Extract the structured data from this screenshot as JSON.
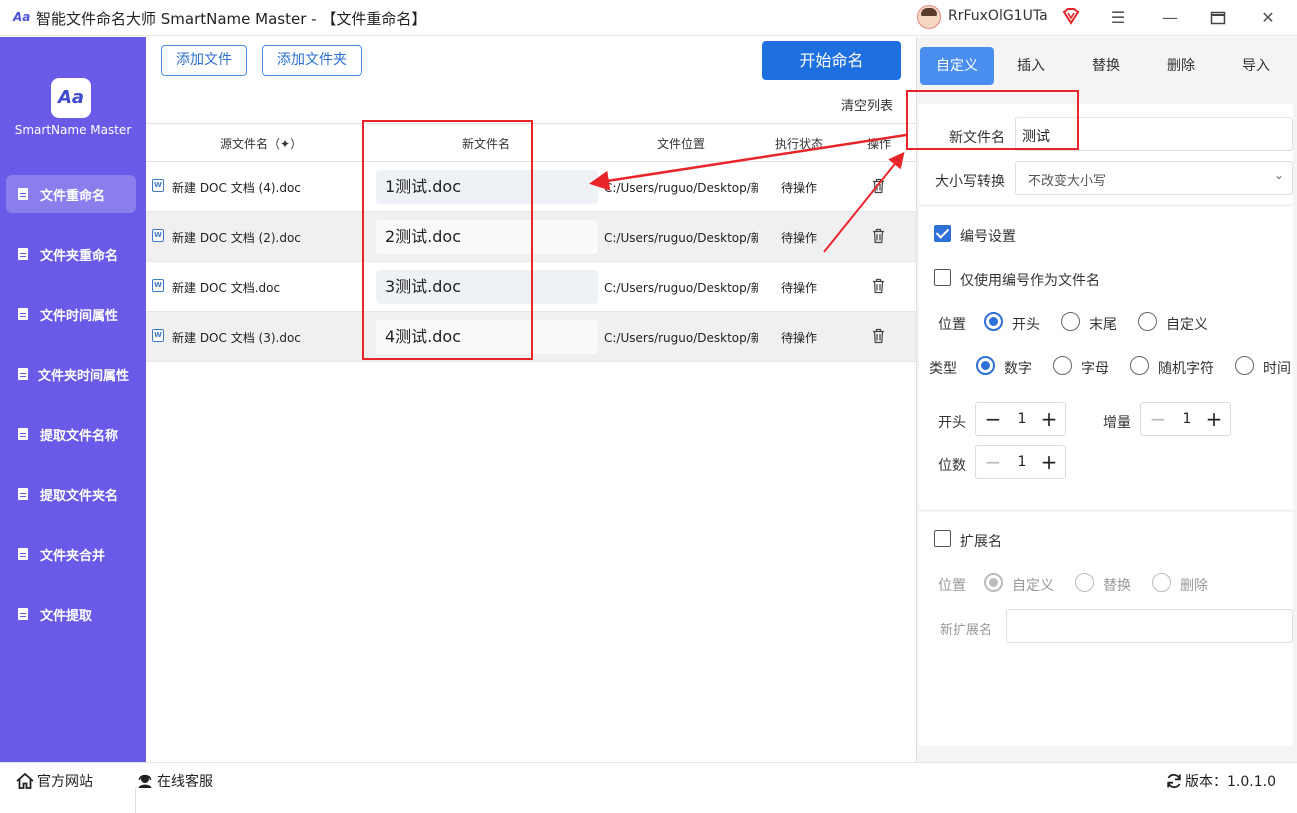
{
  "window": {
    "title": "智能文件命名大师 SmartName Master - 【文件重命名】",
    "app_icon": "Aa",
    "username": "RrFuxOlG1UTa",
    "vip_icon": "diamond-badge-icon",
    "controls": [
      "menu-icon",
      "minimize-icon",
      "maximize-icon",
      "close-icon"
    ]
  },
  "sidebar": {
    "logo_text": "Aa",
    "brand": "SmartName Master",
    "items": [
      {
        "label": "文件重命名",
        "active": true
      },
      {
        "label": "文件夹重命名",
        "active": false
      },
      {
        "label": "文件时间属性",
        "active": false
      },
      {
        "label": "文件夹时间属性",
        "active": false
      },
      {
        "label": "提取文件名称",
        "active": false
      },
      {
        "label": "提取文件夹名",
        "active": false
      },
      {
        "label": "文件夹合并",
        "active": false
      },
      {
        "label": "文件提取",
        "active": false
      }
    ]
  },
  "toolbar": {
    "add_file": "添加文件",
    "add_folder": "添加文件夹",
    "start": "开始命名",
    "clear": "清空列表"
  },
  "table": {
    "headers": {
      "source": "源文件名（",
      "source_sort_icon": "sort-icon",
      "source_close": "）",
      "new_name": "新文件名",
      "location": "文件位置",
      "status": "执行状态",
      "action": "操作"
    },
    "rows": [
      {
        "source": "新建 DOC 文档 (4).doc",
        "new_name": "1测试.doc",
        "location": "C:/Users/ruguo/Desktop/新",
        "status": "待操作"
      },
      {
        "source": "新建 DOC 文档 (2).doc",
        "new_name": "2测试.doc",
        "location": "C:/Users/ruguo/Desktop/新",
        "status": "待操作"
      },
      {
        "source": "新建 DOC 文档.doc",
        "new_name": "3测试.doc",
        "location": "C:/Users/ruguo/Desktop/新",
        "status": "待操作"
      },
      {
        "source": "新建 DOC 文档 (3).doc",
        "new_name": "4测试.doc",
        "location": "C:/Users/ruguo/Desktop/新",
        "status": "待操作"
      }
    ]
  },
  "panel": {
    "tabs": [
      "自定义",
      "插入",
      "替换",
      "删除",
      "导入"
    ],
    "active_tab": "自定义",
    "new_name_label": "新文件名",
    "new_name_value": "测试",
    "case_label": "大小写转换",
    "case_value": "不改变大小写",
    "numbering": {
      "label": "编号设置",
      "checked": true,
      "only_number_label": "仅使用编号作为文件名",
      "only_number_checked": false,
      "position_label": "位置",
      "position_options": [
        "开头",
        "末尾",
        "自定义"
      ],
      "position_selected": "开头",
      "type_label": "类型",
      "type_options": [
        "数字",
        "字母",
        "随机字符",
        "时间"
      ],
      "type_selected": "数字",
      "start_label": "开头",
      "start_value": "1",
      "increment_label": "增量",
      "increment_value": "1",
      "digits_label": "位数",
      "digits_value": "1"
    },
    "extension": {
      "label": "扩展名",
      "checked": false,
      "position_label": "位置",
      "options": [
        "自定义",
        "替换",
        "删除"
      ],
      "selected": "自定义",
      "new_ext_label": "新扩展名",
      "new_ext_value": ""
    }
  },
  "footer": {
    "website": "官方网站",
    "support": "在线客服",
    "version": "版本：1.0.1.0"
  },
  "colors": {
    "sidebar": "#6a5ae8",
    "primary": "#1e6fe0",
    "tab_active": "#4a8ef0",
    "annotation": "#e8262a"
  }
}
